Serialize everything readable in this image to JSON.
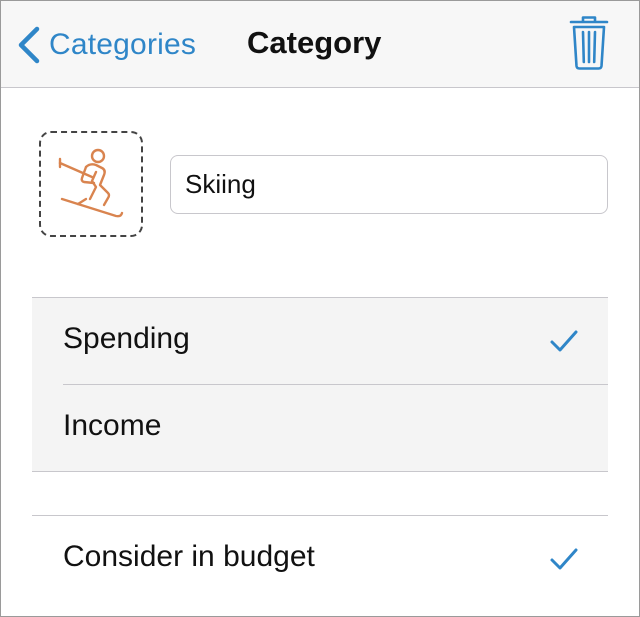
{
  "navbar": {
    "back_label": "Categories",
    "title": "Category",
    "back_icon": "chevron-left-icon",
    "delete_icon": "trash-icon"
  },
  "category": {
    "icon": "skiing-icon",
    "icon_color": "#d9844f",
    "name": "Skiing"
  },
  "type_options": [
    {
      "label": "Spending",
      "selected": true
    },
    {
      "label": "Income",
      "selected": false
    }
  ],
  "budget": {
    "label": "Consider in budget",
    "checked": true
  },
  "colors": {
    "accent": "#2f86c8",
    "nav_bg": "#f7f7f7",
    "group_bg": "#f4f4f4"
  }
}
